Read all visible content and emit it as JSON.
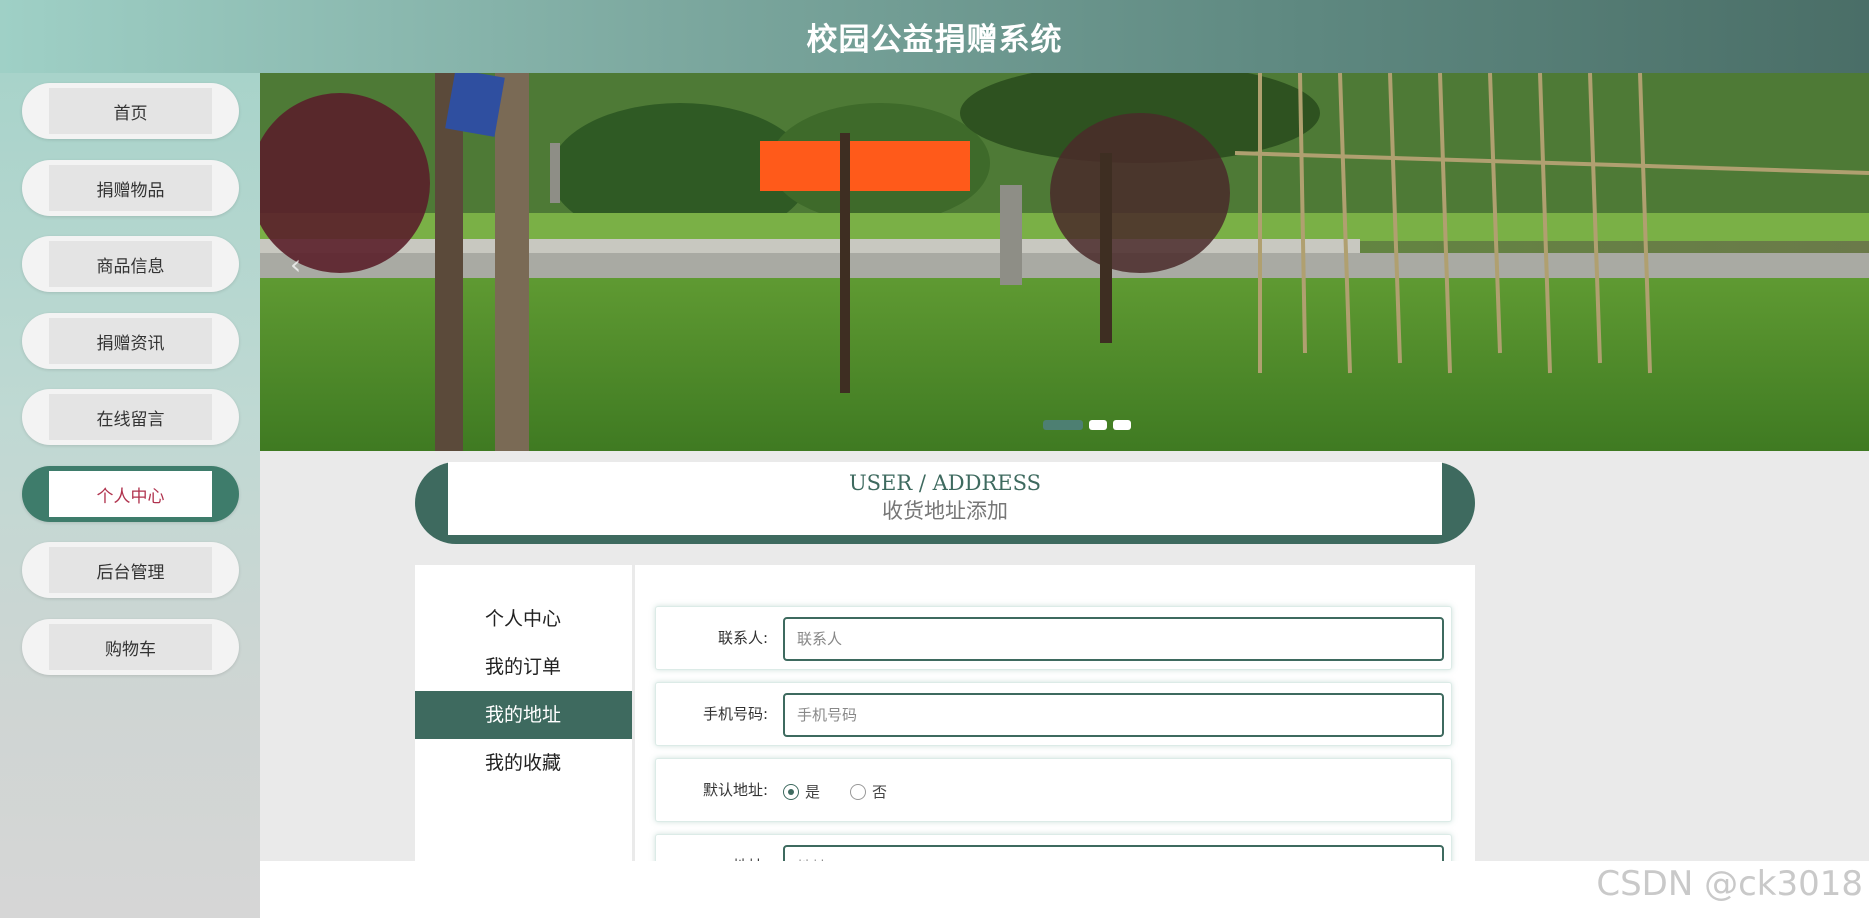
{
  "header": {
    "title": "校园公益捐赠系统"
  },
  "sidebar": {
    "items": [
      {
        "label": "首页",
        "active": false
      },
      {
        "label": "捐赠物品",
        "active": false
      },
      {
        "label": "商品信息",
        "active": false
      },
      {
        "label": "捐赠资讯",
        "active": false
      },
      {
        "label": "在线留言",
        "active": false
      },
      {
        "label": "个人中心",
        "active": true
      },
      {
        "label": "后台管理",
        "active": false
      },
      {
        "label": "购物车",
        "active": false
      }
    ]
  },
  "banner": {
    "arrow_left": "‹",
    "slide_count": 3,
    "active_slide": 1
  },
  "section": {
    "title_en": "USER / ADDRESS",
    "title_cn": "收货地址添加"
  },
  "usermenu": {
    "items": [
      {
        "label": "个人中心",
        "active": false
      },
      {
        "label": "我的订单",
        "active": false
      },
      {
        "label": "我的地址",
        "active": true
      },
      {
        "label": "我的收藏",
        "active": false
      }
    ]
  },
  "form": {
    "contact": {
      "label": "联系人:",
      "placeholder": "联系人",
      "value": ""
    },
    "phone": {
      "label": "手机号码:",
      "placeholder": "手机号码",
      "value": ""
    },
    "default": {
      "label": "默认地址:",
      "yes": "是",
      "no": "否",
      "selected": "是"
    },
    "address": {
      "label": "地址:",
      "placeholder": "地址",
      "value": ""
    }
  },
  "watermark": "CSDN @ck3018",
  "colors": {
    "primary": "#3e6a5f",
    "active_text": "#b0334e",
    "header_start": "#9fd0c6",
    "header_end": "#4a6e67"
  }
}
